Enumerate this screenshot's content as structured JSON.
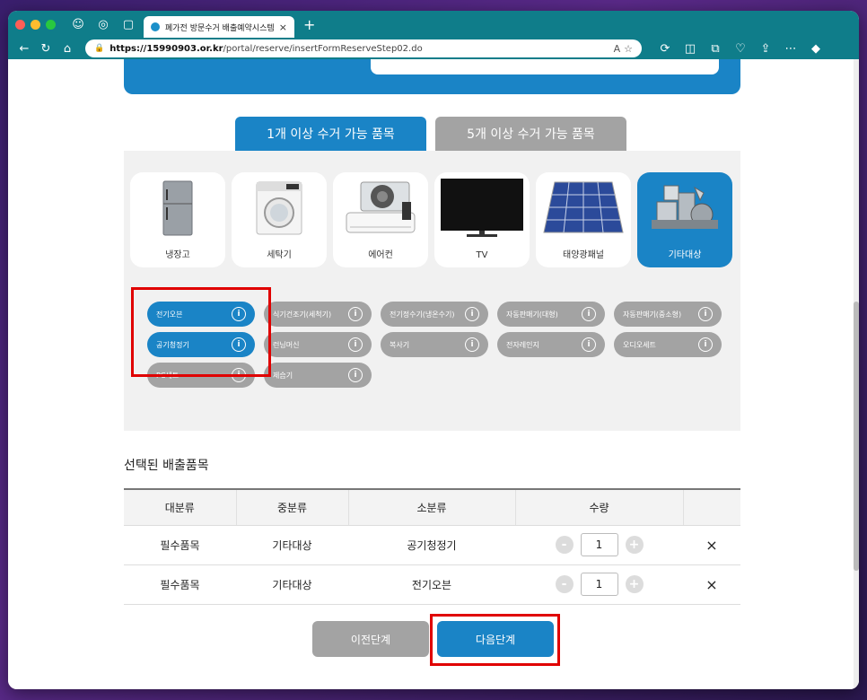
{
  "browser": {
    "tab_title": "폐가전 방문수거 배출예약시스템",
    "tab_close": "×",
    "new_tab": "+",
    "url_host": "https://15990903.or.kr",
    "url_path": "/portal/reserve/insertFormReserveStep02.do"
  },
  "colors": {
    "primary": "#1a84c6",
    "inactive": "#a3a3a3",
    "highlight": "#e00000",
    "chrome": "#0f7d8a"
  },
  "category_tabs": [
    "1개 이상 수거 가능 품목",
    "5개 이상 수거 가능 품목"
  ],
  "cards": [
    "냉장고",
    "세탁기",
    "에어컨",
    "TV",
    "태양광패널",
    "기타대상"
  ],
  "chips": [
    {
      "label": "전기오븐",
      "selected": true
    },
    {
      "label": "식기건조기(세척기)",
      "selected": false
    },
    {
      "label": "전기정수기(냉온수기)",
      "selected": false
    },
    {
      "label": "자동판매기(대형)",
      "selected": false
    },
    {
      "label": "자동판매기(중소형)",
      "selected": false
    },
    {
      "label": "공기청정기",
      "selected": true
    },
    {
      "label": "런닝머신",
      "selected": false
    },
    {
      "label": "복사기",
      "selected": false
    },
    {
      "label": "전자레인지",
      "selected": false
    },
    {
      "label": "오디오세트",
      "selected": false
    },
    {
      "label": "PC세트",
      "selected": false
    },
    {
      "label": "제습기",
      "selected": false
    }
  ],
  "selected_section": {
    "title": "선택된 배출품목",
    "headers": [
      "대분류",
      "중분류",
      "소분류",
      "수량",
      ""
    ],
    "rows": [
      {
        "major": "필수품목",
        "middle": "기타대상",
        "minor": "공기청정기",
        "qty": "1"
      },
      {
        "major": "필수품목",
        "middle": "기타대상",
        "minor": "전기오븐",
        "qty": "1"
      }
    ]
  },
  "buttons": {
    "prev": "이전단계",
    "next": "다음단계",
    "minus": "-",
    "plus": "+",
    "remove": "×",
    "info": "i"
  }
}
